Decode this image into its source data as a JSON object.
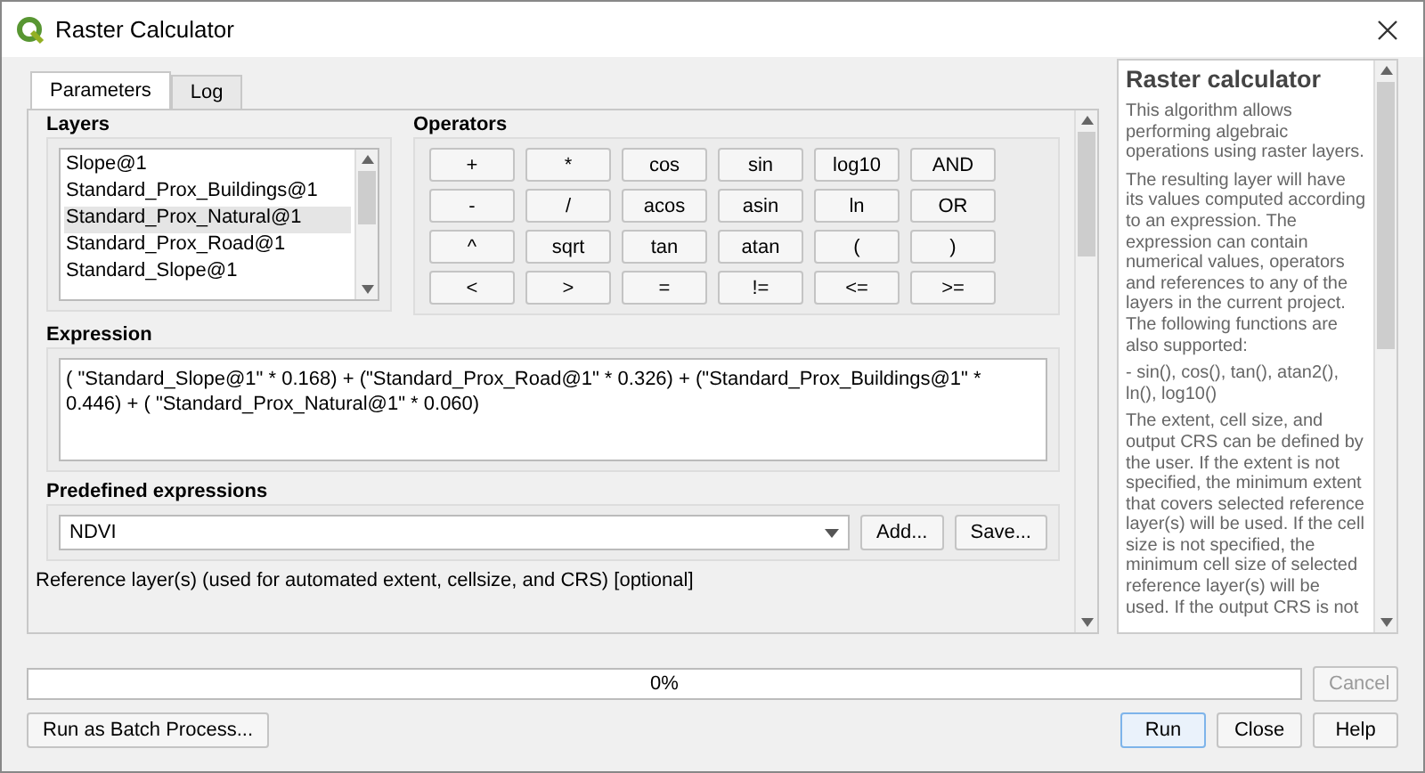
{
  "window": {
    "title": "Raster Calculator"
  },
  "tabs": [
    {
      "label": "Parameters",
      "selected": true
    },
    {
      "label": "Log",
      "selected": false
    }
  ],
  "layers": {
    "label": "Layers",
    "items": [
      {
        "label": "Slope@1",
        "selected": false
      },
      {
        "label": "Standard_Prox_Buildings@1",
        "selected": false
      },
      {
        "label": "Standard_Prox_Natural@1",
        "selected": true
      },
      {
        "label": "Standard_Prox_Road@1",
        "selected": false
      },
      {
        "label": "Standard_Slope@1",
        "selected": false
      }
    ]
  },
  "operators": {
    "label": "Operators",
    "buttons": [
      "+",
      "*",
      "cos",
      "sin",
      "log10",
      "AND",
      "-",
      "/",
      "acos",
      "asin",
      "ln",
      "OR",
      "^",
      "sqrt",
      "tan",
      "atan",
      "(",
      ")",
      "<",
      ">",
      "=",
      "!=",
      "<=",
      ">="
    ]
  },
  "expression": {
    "label": "Expression",
    "value": "( \"Standard_Slope@1\" * 0.168) + (\"Standard_Prox_Road@1\" * 0.326) + (\"Standard_Prox_Buildings@1\" * 0.446) +  ( \"Standard_Prox_Natural@1\" * 0.060)"
  },
  "predefined": {
    "label": "Predefined expressions",
    "value": "NDVI",
    "buttons": [
      "Add...",
      "Save..."
    ]
  },
  "reference_label": "Reference layer(s) (used for automated extent, cellsize, and CRS) [optional]",
  "help": {
    "title": "Raster calculator",
    "paragraphs": [
      "This algorithm allows performing algebraic operations using raster layers.",
      "The resulting layer will have its values computed according to an expression. The expression can contain numerical values, operators and references to any of the layers in the current project. The following functions are also supported:",
      "- sin(), cos(), tan(), atan2(), ln(), log10()",
      "The extent, cell size, and output CRS can be defined by the user. If the extent is not specified, the minimum extent that covers selected reference layer(s) will be used. If the cell size is not specified, the minimum cell size of selected reference layer(s) will be used. If the output CRS is not"
    ]
  },
  "progress": {
    "level": 0,
    "reading": "0%"
  },
  "cancel": {
    "label": "Cancel",
    "disabled": true
  },
  "batch_button": "Run as Batch Process...",
  "footer_buttons": [
    "Run",
    "Close",
    "Help"
  ]
}
